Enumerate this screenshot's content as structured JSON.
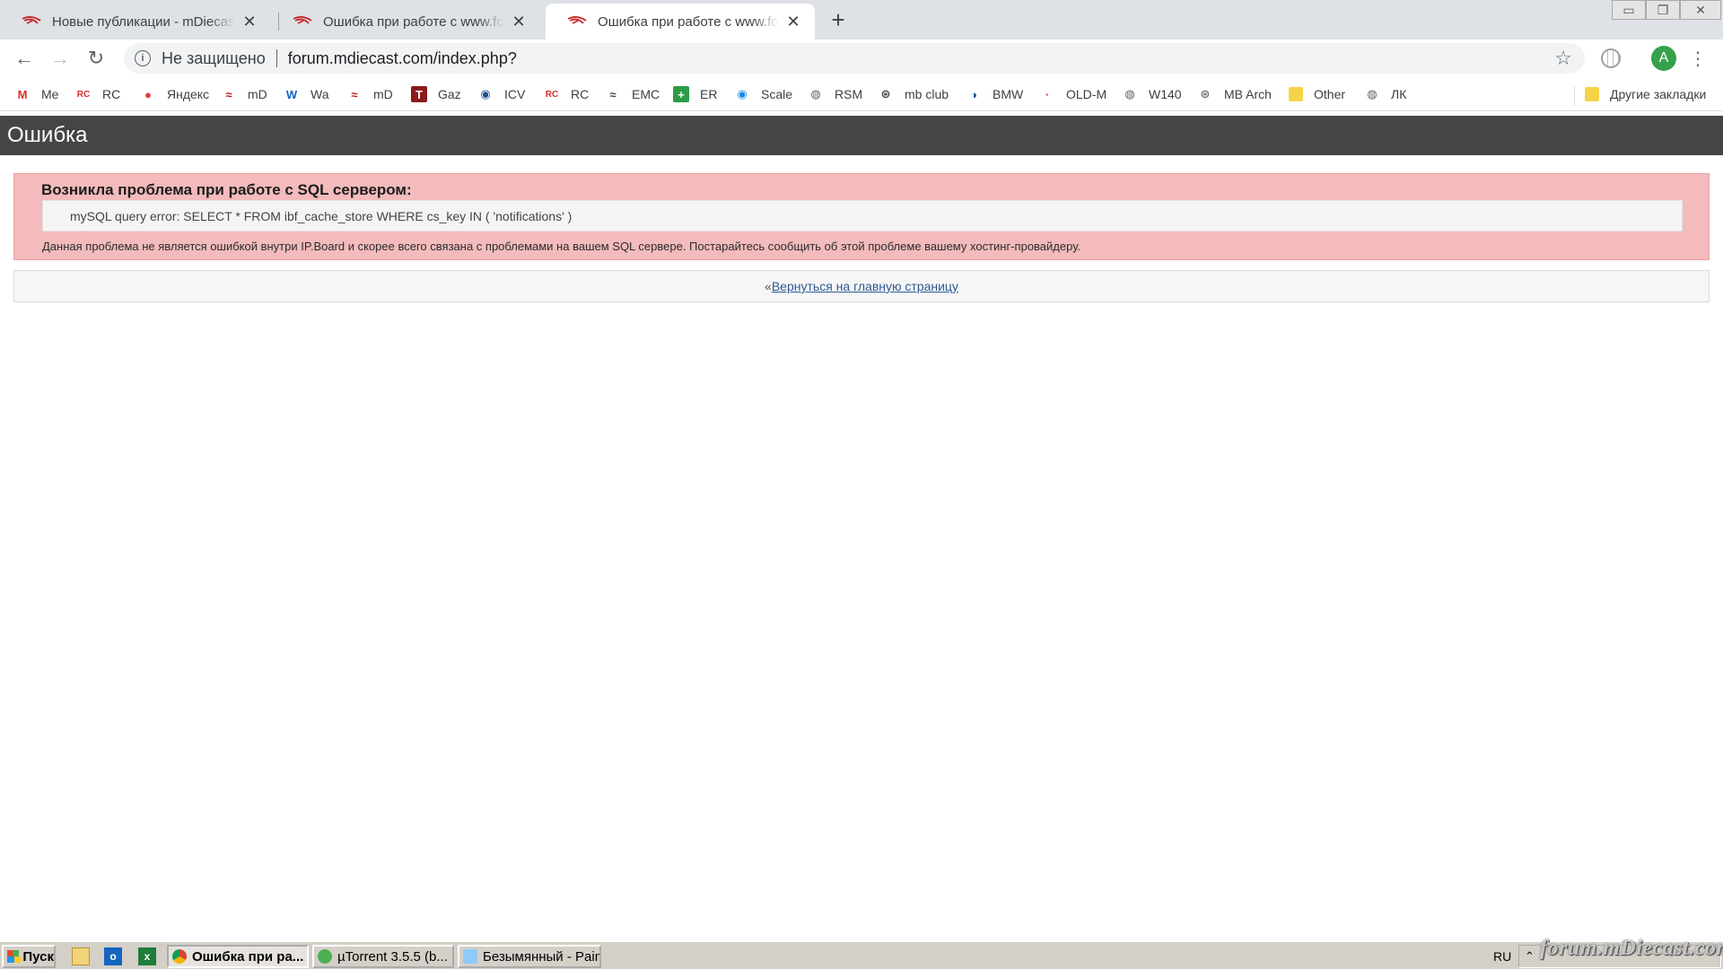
{
  "browser": {
    "tabs": [
      {
        "title": "Новые публикации - mDiecast Forum",
        "active": false
      },
      {
        "title": "Ошибка при работе с www.forum.mdiecast.com",
        "active": false
      },
      {
        "title": "Ошибка при работе с www.forum.mdiecast.com",
        "active": true
      }
    ],
    "new_tab": "+",
    "security_label": "Не защищено",
    "url": "forum.mdiecast.com/index.php?",
    "profile_initial": "A",
    "bookmarks": [
      {
        "label": "Me",
        "icon": "mail-icon",
        "color": "#d93025"
      },
      {
        "label": "RC",
        "icon": "rc-icon",
        "color": "#d32f2f"
      },
      {
        "label": "Яндекс",
        "icon": "map-pin-icon",
        "color": "#e53935"
      },
      {
        "label": "mD",
        "icon": "mdiecast-icon",
        "color": "#b71c1c"
      },
      {
        "label": "Wa",
        "icon": "w-icon",
        "color": "#1565c0"
      },
      {
        "label": "mD",
        "icon": "mdiecast-icon",
        "color": "#b71c1c"
      },
      {
        "label": "Gaz",
        "icon": "t-icon",
        "color": "#8b1a1a"
      },
      {
        "label": "ICV",
        "icon": "car-icon",
        "color": "#1e4e8c"
      },
      {
        "label": "RC",
        "icon": "rc-icon",
        "color": "#d32f2f"
      },
      {
        "label": "EMC",
        "icon": "mdiecast-icon",
        "color": "#37474f"
      },
      {
        "label": "ER",
        "icon": "plus-icon",
        "color": "#2e9b47"
      },
      {
        "label": "Scale",
        "icon": "car-icon",
        "color": "#1e88e5"
      },
      {
        "label": "RSM",
        "icon": "globe-icon",
        "color": "#616161"
      },
      {
        "label": "mb club",
        "icon": "mercedes-icon",
        "color": "#424242"
      },
      {
        "label": "BMW",
        "icon": "bmw-icon",
        "color": "#1a4f9c"
      },
      {
        "label": "OLD-M",
        "icon": "small-logo-icon",
        "color": "#c62828"
      },
      {
        "label": "W140",
        "icon": "globe-icon",
        "color": "#616161"
      },
      {
        "label": "MB Arch",
        "icon": "mercedes-icon",
        "color": "#757575"
      },
      {
        "label": "Other",
        "icon": "folder-icon",
        "color": "#f6d44a"
      },
      {
        "label": "ЛК",
        "icon": "globe-icon",
        "color": "#616161"
      }
    ],
    "other_bookmarks": "Другие закладки"
  },
  "page": {
    "header": "Ошибка",
    "error_title": "Возникла проблема при работе с SQL сервером:",
    "error_code": "mySQL query error: SELECT * FROM ibf_cache_store WHERE cs_key IN ( 'notifications' )",
    "error_description": "Данная проблема не является ошибкой внутри IP.Board и скорее всего связана с проблемами на вашем SQL сервере. Постарайтесь сообщить об этой проблеме вашему хостинг-провайдеру.",
    "back_prefix": "«",
    "back_link": "Вернуться на главную страницу"
  },
  "taskbar": {
    "start": "Пуск",
    "buttons": [
      {
        "label": "Ошибка при ра...",
        "active": true
      },
      {
        "label": "µTorrent 3.5.5  (b...",
        "active": false
      },
      {
        "label": "Безымянный - Paint",
        "active": false
      }
    ],
    "lang": "RU",
    "watermark": "forum.mDiecast.com"
  }
}
